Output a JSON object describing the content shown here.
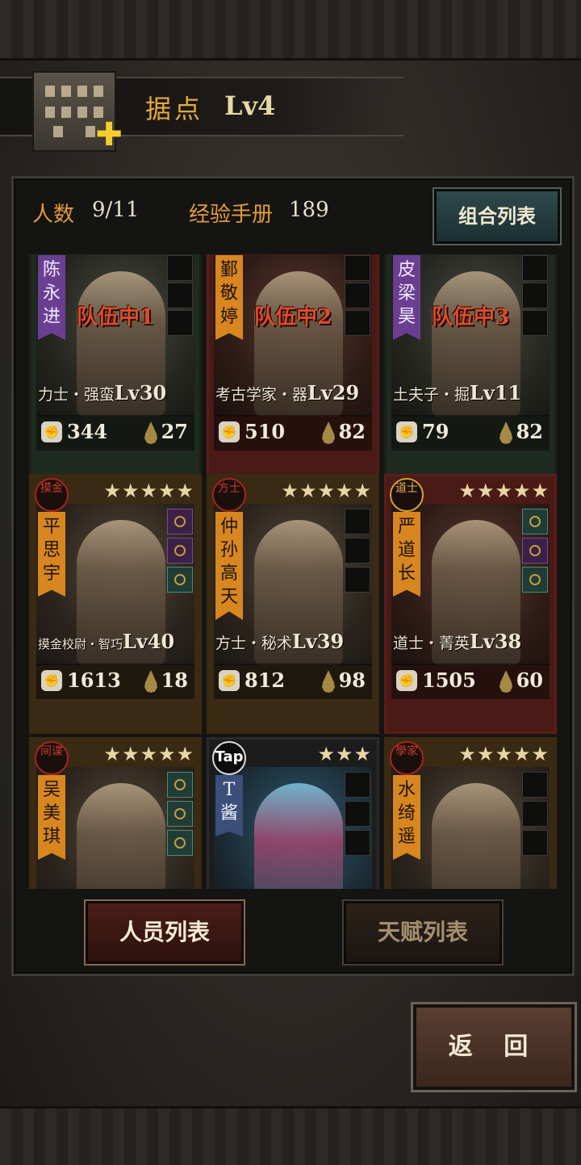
{
  "header": {
    "title": "据点",
    "level": "Lv4"
  },
  "stats": {
    "members_label": "人数",
    "members_value": "9/11",
    "manual_label": "经验手册",
    "manual_value": "189"
  },
  "combo_button": "组合列表",
  "cards": [
    {
      "name": "陈永进",
      "banner": "purple",
      "team": "队伍中1",
      "role": "力士・强蛮",
      "level": "Lv30",
      "power": "344",
      "stamina": "27",
      "badge": "",
      "stars": ""
    },
    {
      "name": "鄞敬婷",
      "banner": "orange",
      "team": "队伍中2",
      "role": "考古学家・器",
      "level": "Lv29",
      "power": "510",
      "stamina": "82",
      "badge": "",
      "stars": ""
    },
    {
      "name": "皮梁昊",
      "banner": "purple",
      "team": "队伍中3",
      "role": "土夫子・掘",
      "level": "Lv11",
      "power": "79",
      "stamina": "82",
      "badge": "",
      "stars": ""
    },
    {
      "name": "平思宇",
      "banner": "orange",
      "team": "",
      "role": "摸金校尉・智巧",
      "level": "Lv40",
      "power": "1613",
      "stamina": "18",
      "badge": "摸金",
      "stars": "★★★★★"
    },
    {
      "name": "仲孙高天",
      "banner": "orange",
      "team": "",
      "role": "方士・秘术",
      "level": "Lv39",
      "power": "812",
      "stamina": "98",
      "badge": "方士",
      "stars": "★★★★★"
    },
    {
      "name": "严道长",
      "banner": "orange",
      "team": "",
      "role": "道士・菁英",
      "level": "Lv38",
      "power": "1505",
      "stamina": "60",
      "badge": "道士",
      "stars": "★★★★★"
    },
    {
      "name": "吴美琪",
      "banner": "orange",
      "team": "",
      "role": "",
      "level": "",
      "power": "",
      "stamina": "",
      "badge": "间谍",
      "stars": "★★★★★"
    },
    {
      "name": "T酱",
      "banner": "blue",
      "team": "",
      "role": "",
      "level": "",
      "power": "",
      "stamina": "",
      "badge": "Tap",
      "stars": "★★★"
    },
    {
      "name": "水绮遥",
      "banner": "orange",
      "team": "",
      "role": "",
      "level": "",
      "power": "",
      "stamina": "",
      "badge": "學家",
      "stars": "★★★★★"
    }
  ],
  "tabs": {
    "staff": "人员列表",
    "talent": "天赋列表"
  },
  "back_button": "返 回",
  "icons": {
    "fist": "fist-icon",
    "drop": "stamina-drop-icon",
    "plus": "plus-icon"
  }
}
